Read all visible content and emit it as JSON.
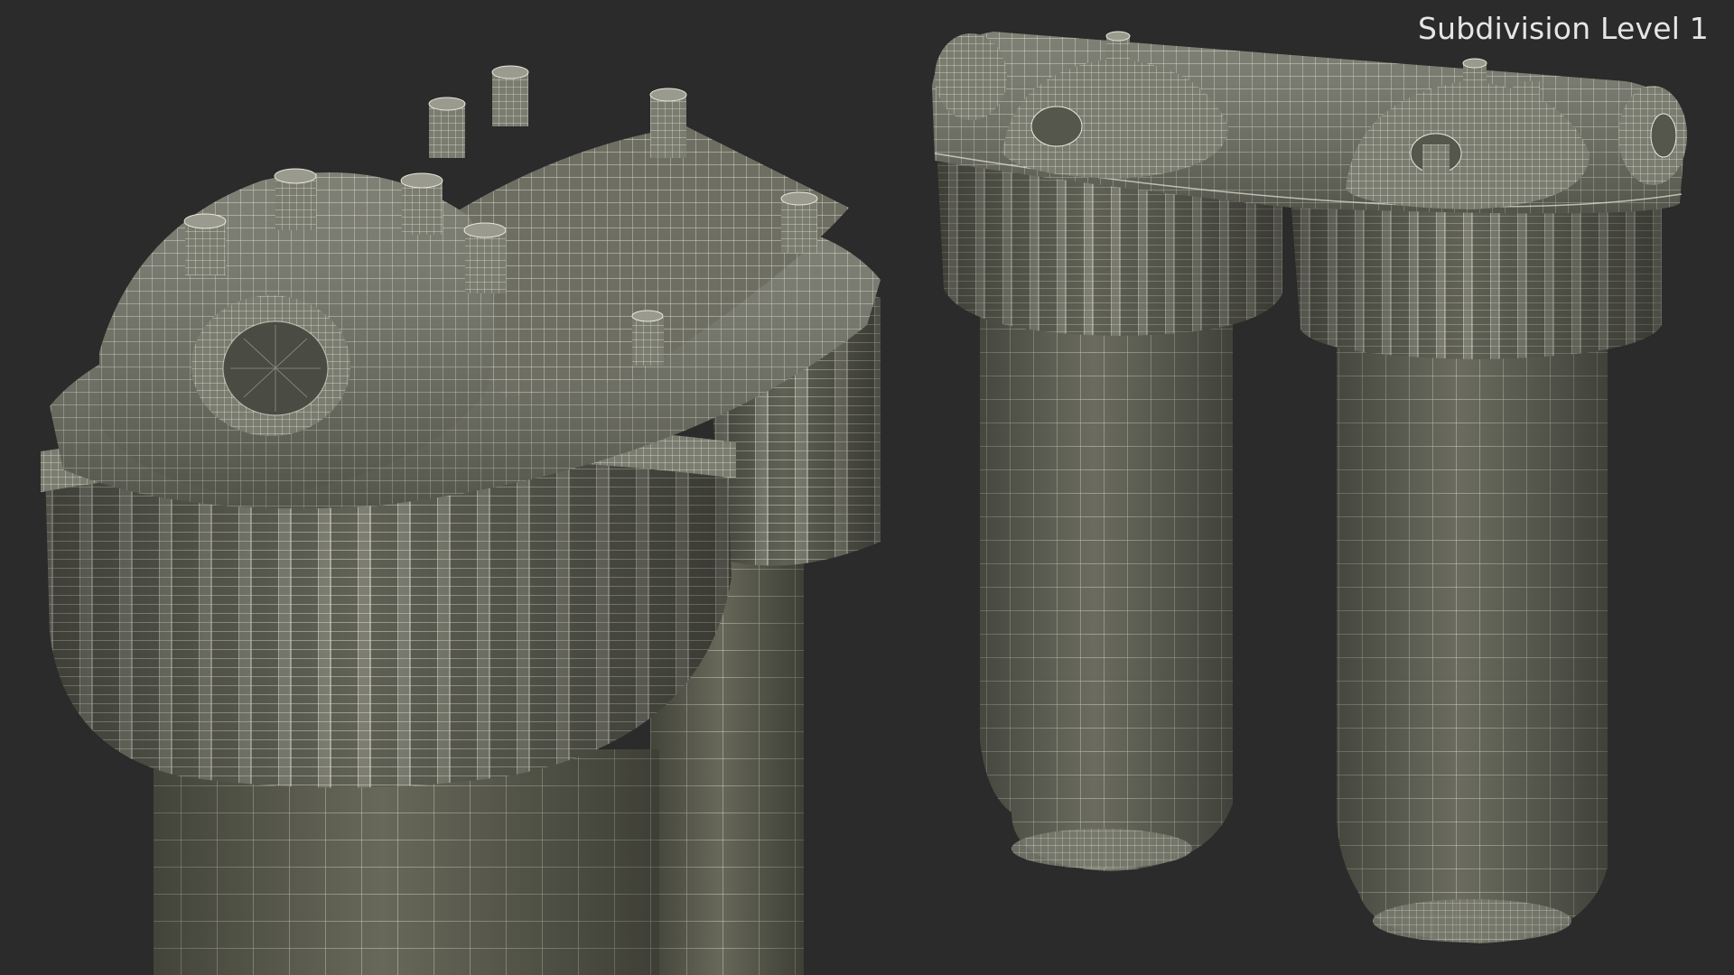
{
  "overlay": {
    "label": "Subdivision Level 1"
  },
  "scene": {
    "subject": "twin-filter-housing-wireframe",
    "views": [
      "close-up-view",
      "front-view"
    ]
  },
  "colors": {
    "background": "#2a2b2a",
    "mesh_fill": "#6e6f62",
    "mesh_fill_light": "#85867a",
    "mesh_fill_dark": "#55564c",
    "wire": "#e8e8dc"
  }
}
